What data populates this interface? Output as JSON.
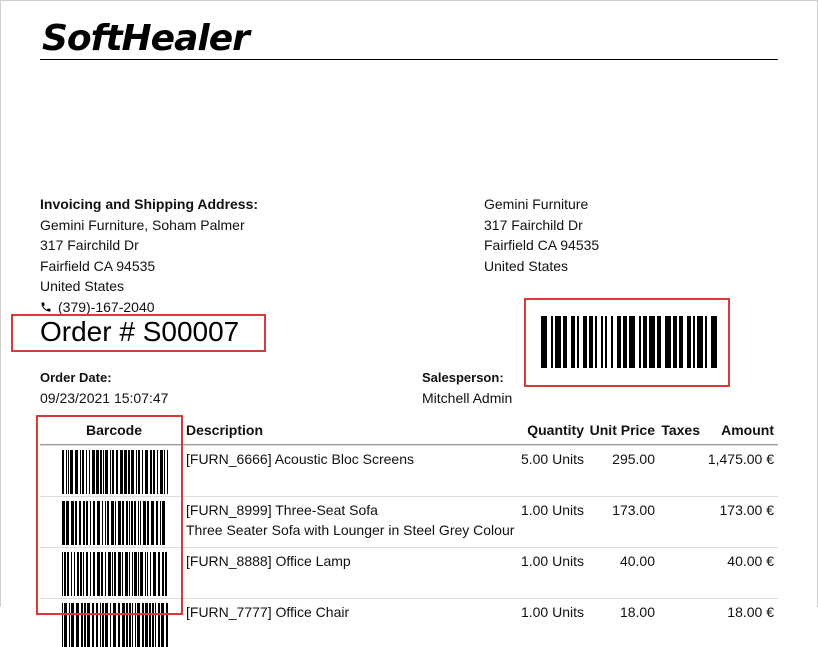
{
  "brand": {
    "logo_text": "SoftHealer"
  },
  "billing": {
    "heading": "Invoicing and Shipping Address:",
    "lines": [
      "Gemini Furniture, Soham Palmer",
      "317 Fairchild Dr",
      "Fairfield CA 94535",
      "United States"
    ],
    "phone": "(379)-167-2040"
  },
  "company": {
    "lines": [
      "Gemini Furniture",
      "317 Fairchild Dr",
      "Fairfield CA 94535",
      "United States"
    ]
  },
  "order": {
    "title": "Order # S00007",
    "date_label": "Order Date:",
    "date_value": "09/23/2021 15:07:47",
    "salesperson_label": "Salesperson:",
    "salesperson_value": "Mitchell Admin"
  },
  "table": {
    "headers": {
      "barcode": "Barcode",
      "description": "Description",
      "quantity": "Quantity",
      "unit_price": "Unit Price",
      "taxes": "Taxes",
      "amount": "Amount"
    },
    "rows": [
      {
        "description": "[FURN_6666] Acoustic Bloc Screens",
        "description2": "",
        "quantity": "5.00 Units",
        "unit_price": "295.00",
        "taxes": "",
        "amount": "1,475.00 €"
      },
      {
        "description": "[FURN_8999] Three-Seat Sofa",
        "description2": "Three Seater Sofa with Lounger in Steel Grey Colour",
        "quantity": "1.00 Units",
        "unit_price": "173.00",
        "taxes": "",
        "amount": "173.00 €"
      },
      {
        "description": "[FURN_8888] Office Lamp",
        "description2": "",
        "quantity": "1.00 Units",
        "unit_price": "40.00",
        "taxes": "",
        "amount": "40.00 €"
      },
      {
        "description": "[FURN_7777] Office Chair",
        "description2": "",
        "quantity": "1.00 Units",
        "unit_price": "18.00",
        "taxes": "",
        "amount": "18.00 €"
      }
    ]
  },
  "colors": {
    "highlight": "#d83a3a",
    "text": "#111111"
  }
}
